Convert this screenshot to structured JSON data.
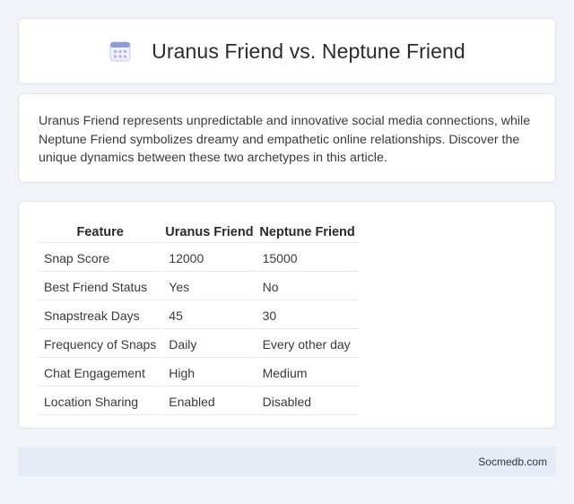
{
  "header": {
    "icon": "calendar-icon",
    "title": "Uranus Friend vs. Neptune Friend"
  },
  "intro": {
    "text": "Uranus Friend represents unpredictable and innovative social media connections, while Neptune Friend symbolizes dreamy and empathetic online relationships. Discover the unique dynamics between these two archetypes in this article."
  },
  "table": {
    "headers": [
      "Feature",
      "Uranus Friend",
      "Neptune Friend"
    ],
    "rows": [
      [
        "Snap Score",
        "12000",
        "15000"
      ],
      [
        "Best Friend Status",
        "Yes",
        "No"
      ],
      [
        "Snapstreak Days",
        "45",
        "30"
      ],
      [
        "Frequency of Snaps",
        "Daily",
        "Every other day"
      ],
      [
        "Chat Engagement",
        "High",
        "Medium"
      ],
      [
        "Location Sharing",
        "Enabled",
        "Disabled"
      ]
    ]
  },
  "footer": {
    "text": "Socmedb.com"
  },
  "colors": {
    "background": "#f0f3f8",
    "footer_background": "#e6ecf6",
    "icon_accent": "#8e9bd6"
  }
}
